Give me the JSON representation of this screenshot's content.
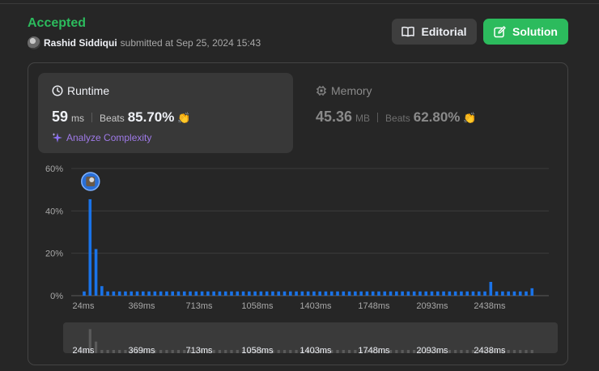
{
  "header": {
    "status": "Accepted",
    "username": "Rashid Siddiqui",
    "submitted_text": "submitted at Sep 25, 2024 15:43"
  },
  "buttons": {
    "editorial": "Editorial",
    "solution": "Solution"
  },
  "runtime": {
    "title": "Runtime",
    "value": "59",
    "unit": "ms",
    "beats_label": "Beats",
    "beats_value": "85.70%",
    "analyze_label": "Analyze Complexity"
  },
  "memory": {
    "title": "Memory",
    "value": "45.36",
    "unit": "MB",
    "beats_label": "Beats",
    "beats_value": "62.80%"
  },
  "colors": {
    "accepted": "#2cbb5d",
    "bar": "#1a73e8",
    "analyze": "#9f7ae8"
  },
  "chart_data": {
    "type": "bar",
    "y_ticks": [
      "60%",
      "40%",
      "20%",
      "0%"
    ],
    "ylim": [
      0,
      60
    ],
    "x_ticks": [
      "24ms",
      "369ms",
      "713ms",
      "1058ms",
      "1403ms",
      "1748ms",
      "2093ms",
      "2438ms"
    ],
    "values": [
      2,
      45.5,
      22,
      4.5,
      2,
      2,
      2,
      2,
      2,
      2,
      2,
      2,
      2,
      2,
      2,
      2,
      2,
      2,
      2,
      2,
      2,
      2,
      2,
      2,
      2,
      2,
      2,
      2,
      2,
      2,
      2,
      2,
      2,
      2,
      2,
      2,
      2,
      2,
      2,
      2,
      2,
      2,
      2,
      2,
      2,
      2,
      2,
      2,
      2,
      2,
      2,
      2,
      2,
      2,
      2,
      2,
      2,
      2,
      2,
      2,
      2,
      2,
      2,
      2,
      2,
      2,
      2,
      2,
      2,
      6.5,
      2,
      2,
      2,
      2,
      2,
      2,
      3.5
    ],
    "highlight_index": 1
  }
}
